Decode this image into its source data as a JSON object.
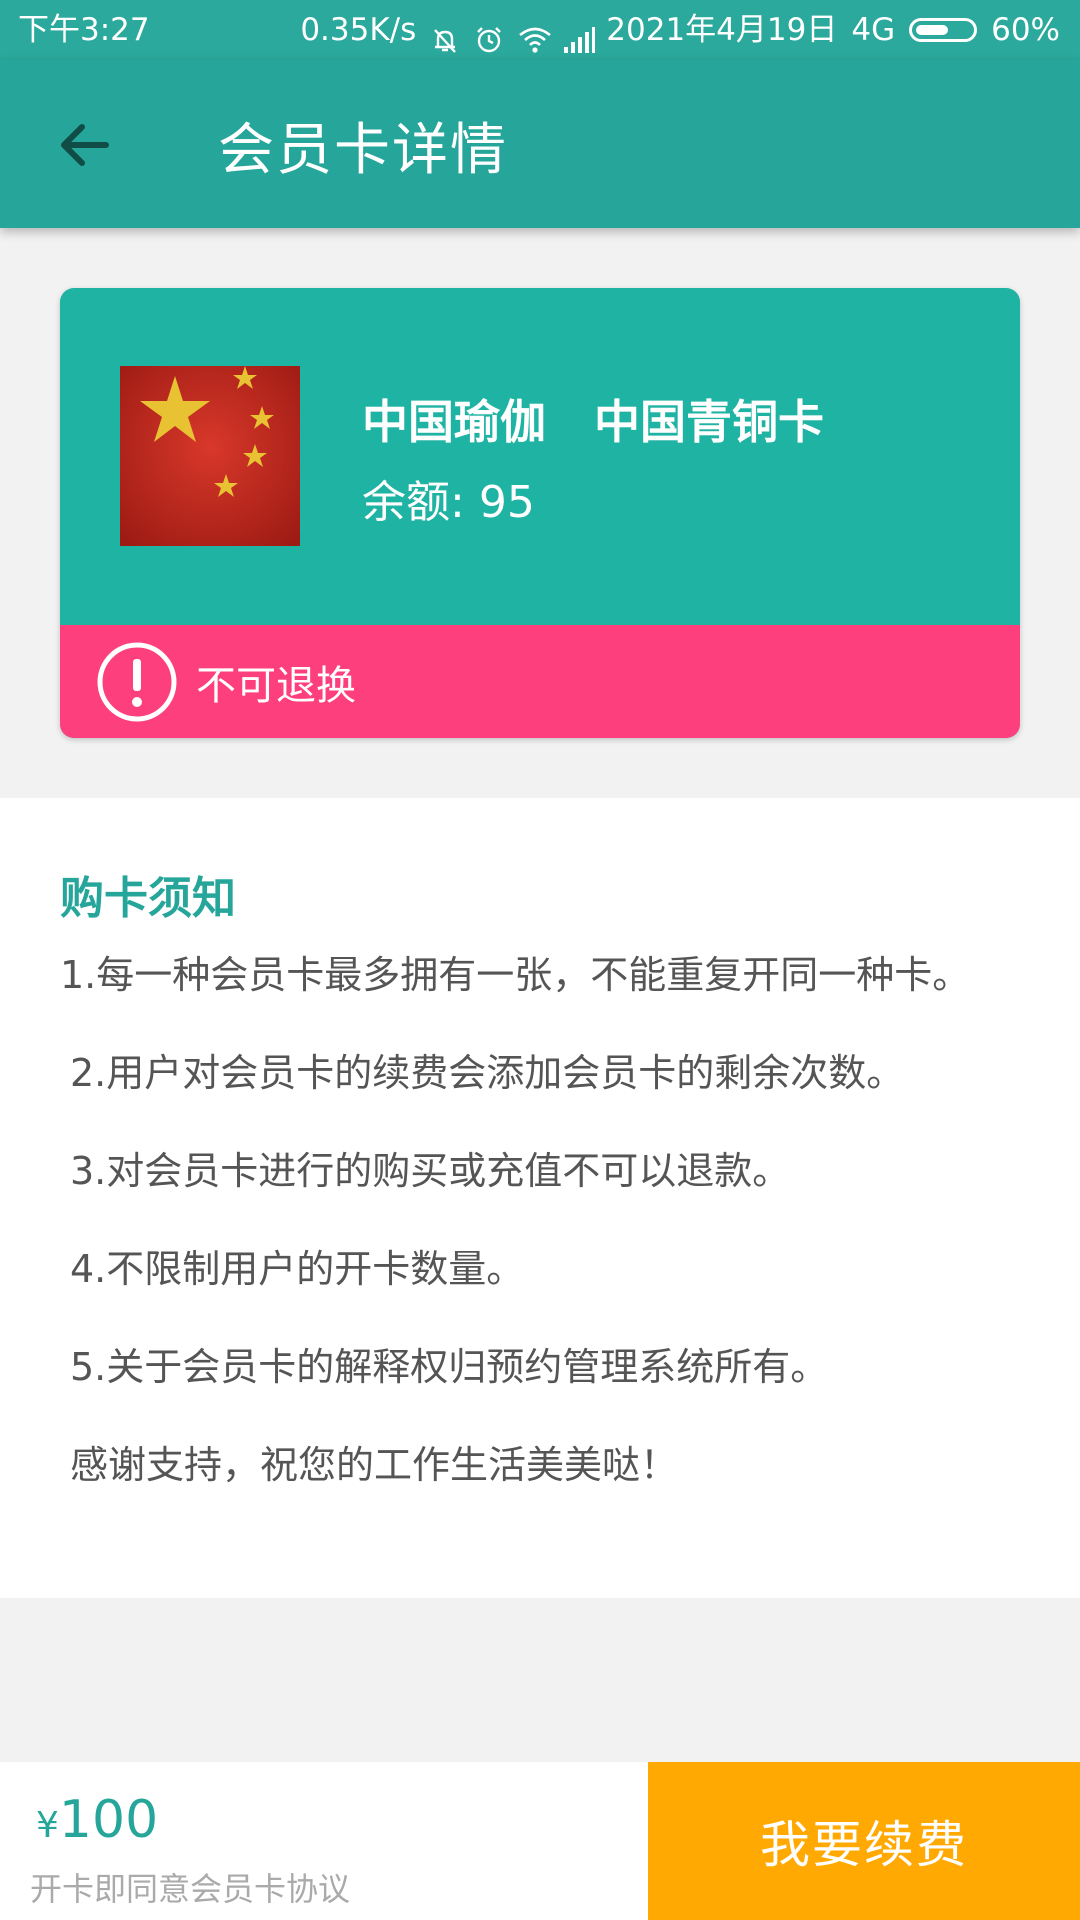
{
  "status_bar": {
    "time": "下午3:27",
    "speed": "0.35K/s",
    "date": "2021年4月19日",
    "network": "4G",
    "battery": "60%",
    "battery_level": 0.6,
    "icons": [
      "mute-bell-icon",
      "alarm-icon",
      "wifi-icon",
      "signal-icon",
      "battery-icon"
    ]
  },
  "app_bar": {
    "title": "会员卡详情",
    "back_icon": "arrow-left-icon"
  },
  "card": {
    "title": "中国瑜伽   中国青铜卡",
    "balance_label": "余额:",
    "balance_value": "95",
    "warning": "不可退换",
    "colors": {
      "card": "#1fb3a3",
      "warning": "#fd3f7e"
    }
  },
  "notice": {
    "heading": "购卡须知",
    "lines": [
      "1.每一种会员卡最多拥有一张，不能重复开同一种卡。",
      "2.用户对会员卡的续费会添加会员卡的剩余次数。",
      "3.对会员卡进行的购买或充值不可以退款。",
      "4.不限制用户的开卡数量。",
      "5.关于会员卡的解释权归预约管理系统所有。",
      "感谢支持，祝您的工作生活美美哒！"
    ]
  },
  "bottom_bar": {
    "currency": "¥",
    "price": "100",
    "agreement": "开卡即同意会员卡协议",
    "renew_button": "我要续费",
    "colors": {
      "accent": "#26a69a",
      "button": "#ffa902"
    }
  }
}
